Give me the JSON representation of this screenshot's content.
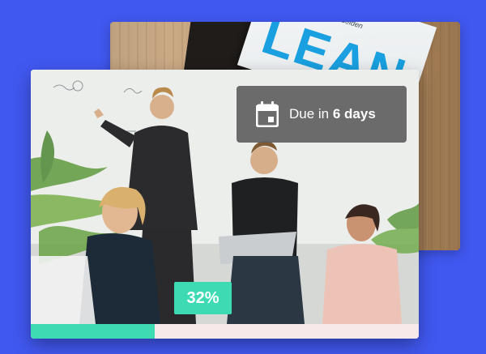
{
  "back_card": {
    "book_subtitle": "ed with Josh Seiden",
    "book_title": "LEAN"
  },
  "due_badge": {
    "icon": "calendar-icon",
    "prefix": "Due in",
    "emphasis": "6 days"
  },
  "progress": {
    "label": "32%",
    "value": 0.32,
    "fill_color": "#3ddab4",
    "track_color": "#f7e9ea"
  },
  "colors": {
    "background": "#4158f0",
    "badge_background": "#5f5f61",
    "accent": "#3ddab4"
  }
}
